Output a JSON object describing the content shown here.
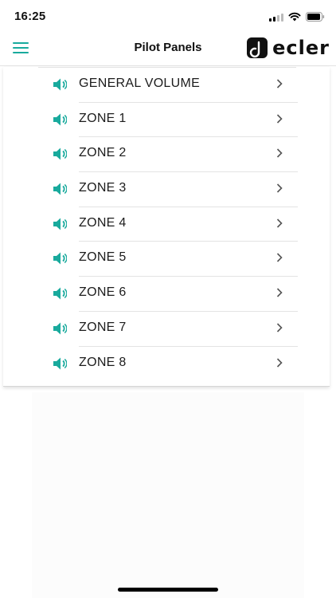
{
  "status_bar": {
    "time": "16:25"
  },
  "nav": {
    "title": "Pilot Panels",
    "brand": "ecler"
  },
  "panels": [
    {
      "label": "GENERAL VOLUME",
      "icon": "speaker-icon"
    },
    {
      "label": "ZONE 1",
      "icon": "speaker-icon"
    },
    {
      "label": "ZONE 2",
      "icon": "speaker-icon"
    },
    {
      "label": "ZONE 3",
      "icon": "speaker-icon"
    },
    {
      "label": "ZONE 4",
      "icon": "speaker-icon"
    },
    {
      "label": "ZONE 5",
      "icon": "speaker-icon"
    },
    {
      "label": "ZONE 6",
      "icon": "speaker-icon"
    },
    {
      "label": "ZONE 7",
      "icon": "speaker-icon"
    },
    {
      "label": "ZONE 8",
      "icon": "speaker-icon"
    }
  ],
  "colors": {
    "accent": "#19aa9d",
    "text": "#1c1c1c",
    "divider": "#e3e3e3"
  }
}
